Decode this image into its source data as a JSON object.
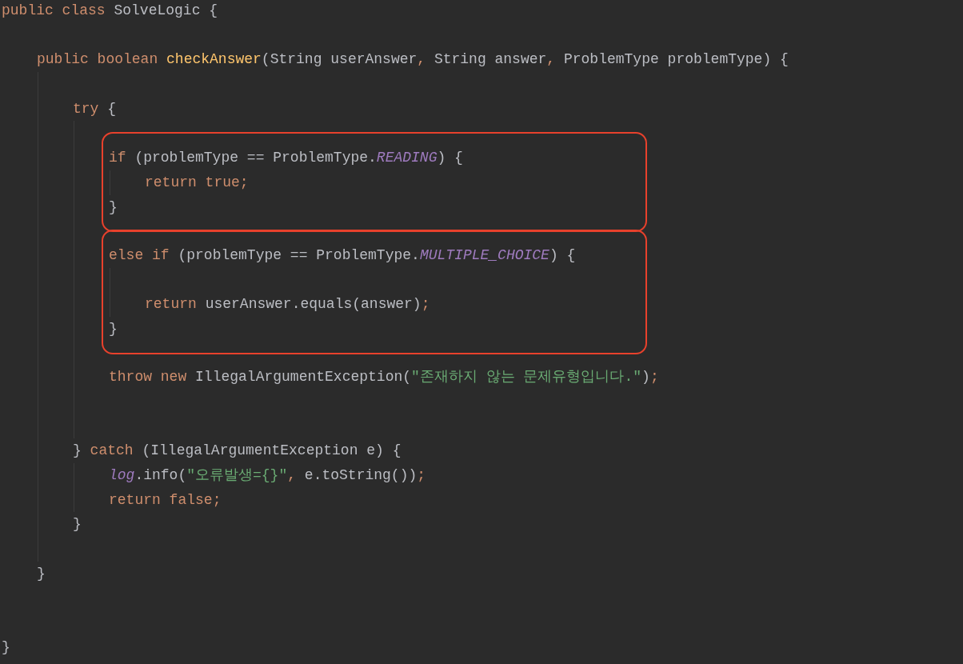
{
  "code": [
    {
      "kind": "line",
      "tokens": [
        {
          "kind": "kw",
          "text": "public class "
        },
        {
          "kind": "plain",
          "text": "SolveLogic {"
        }
      ],
      "children": [
        {
          "kind": "blank"
        },
        {
          "kind": "line",
          "tokens": [
            {
              "kind": "kw",
              "text": "public boolean "
            },
            {
              "kind": "fn",
              "text": "checkAnswer"
            },
            {
              "kind": "plain",
              "text": "(String userAnswer"
            },
            {
              "kind": "punct",
              "text": ", "
            },
            {
              "kind": "plain",
              "text": "String answer"
            },
            {
              "kind": "punct",
              "text": ", "
            },
            {
              "kind": "plain",
              "text": "ProblemType problemType) {"
            }
          ],
          "children": [
            {
              "kind": "blank"
            },
            {
              "kind": "line",
              "tokens": [
                {
                  "kind": "kw",
                  "text": "try "
                },
                {
                  "kind": "plain",
                  "text": "{"
                }
              ],
              "children": [
                {
                  "kind": "blank"
                },
                {
                  "kind": "highlight",
                  "items": [
                    {
                      "kind": "line",
                      "tokens": [
                        {
                          "kind": "kw",
                          "text": "if "
                        },
                        {
                          "kind": "plain",
                          "text": "(problemType == ProblemType."
                        },
                        {
                          "kind": "const",
                          "text": "READING"
                        },
                        {
                          "kind": "plain",
                          "text": ") {"
                        }
                      ],
                      "children": [
                        {
                          "kind": "line",
                          "tokens": [
                            {
                              "kind": "kw",
                              "text": "return true"
                            },
                            {
                              "kind": "punct",
                              "text": ";"
                            }
                          ]
                        }
                      ]
                    },
                    {
                      "kind": "line",
                      "tokens": [
                        {
                          "kind": "plain",
                          "text": "}"
                        }
                      ]
                    }
                  ]
                },
                {
                  "kind": "blank"
                },
                {
                  "kind": "highlight",
                  "items": [
                    {
                      "kind": "line",
                      "tokens": [
                        {
                          "kind": "kw",
                          "text": "else if "
                        },
                        {
                          "kind": "plain",
                          "text": "(problemType == ProblemType."
                        },
                        {
                          "kind": "const",
                          "text": "MULTIPLE_CHOICE"
                        },
                        {
                          "kind": "plain",
                          "text": ") {"
                        }
                      ],
                      "children": [
                        {
                          "kind": "blank"
                        },
                        {
                          "kind": "line",
                          "tokens": [
                            {
                              "kind": "kw",
                              "text": "return "
                            },
                            {
                              "kind": "plain",
                              "text": "userAnswer.equals(answer)"
                            },
                            {
                              "kind": "punct",
                              "text": ";"
                            }
                          ]
                        }
                      ]
                    },
                    {
                      "kind": "line",
                      "tokens": [
                        {
                          "kind": "plain",
                          "text": "}"
                        }
                      ]
                    }
                  ]
                },
                {
                  "kind": "blank"
                },
                {
                  "kind": "line",
                  "tokens": [
                    {
                      "kind": "kw",
                      "text": "throw new "
                    },
                    {
                      "kind": "plain",
                      "text": "IllegalArgumentException("
                    },
                    {
                      "kind": "str",
                      "text": "\"존재하지 않는 문제유형입니다.\""
                    },
                    {
                      "kind": "plain",
                      "text": ")"
                    },
                    {
                      "kind": "punct",
                      "text": ";"
                    }
                  ]
                },
                {
                  "kind": "blank"
                },
                {
                  "kind": "blank"
                }
              ]
            },
            {
              "kind": "line",
              "tokens": [
                {
                  "kind": "plain",
                  "text": "} "
                },
                {
                  "kind": "kw",
                  "text": "catch "
                },
                {
                  "kind": "plain",
                  "text": "(IllegalArgumentException e) {"
                }
              ],
              "children": [
                {
                  "kind": "line",
                  "tokens": [
                    {
                      "kind": "const",
                      "text": "log"
                    },
                    {
                      "kind": "plain",
                      "text": ".info("
                    },
                    {
                      "kind": "str",
                      "text": "\"오류발생={}\""
                    },
                    {
                      "kind": "punct",
                      "text": ", "
                    },
                    {
                      "kind": "plain",
                      "text": "e.toString())"
                    },
                    {
                      "kind": "punct",
                      "text": ";"
                    }
                  ]
                },
                {
                  "kind": "line",
                  "tokens": [
                    {
                      "kind": "kw",
                      "text": "return false"
                    },
                    {
                      "kind": "punct",
                      "text": ";"
                    }
                  ]
                }
              ]
            },
            {
              "kind": "line",
              "tokens": [
                {
                  "kind": "plain",
                  "text": "}"
                }
              ]
            },
            {
              "kind": "blank"
            }
          ]
        },
        {
          "kind": "line",
          "tokens": [
            {
              "kind": "plain",
              "text": "}"
            }
          ]
        },
        {
          "kind": "blank"
        },
        {
          "kind": "blank"
        }
      ]
    },
    {
      "kind": "line",
      "tokens": [
        {
          "kind": "plain",
          "text": "}"
        }
      ]
    }
  ]
}
